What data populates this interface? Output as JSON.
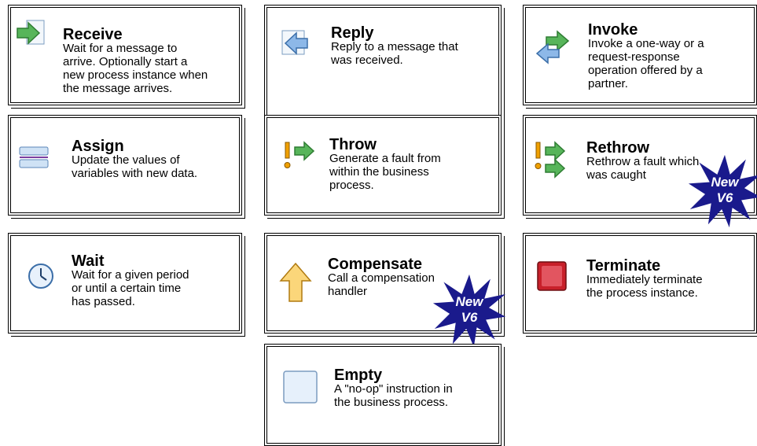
{
  "activities": [
    {
      "id": "receive",
      "title": "Receive",
      "description": "Wait for a message to\narrive. Optionally start a\nnew process instance when\nthe message arrives.",
      "icon": "receive-arrow-icon"
    },
    {
      "id": "reply",
      "title": "Reply",
      "description": "Reply to a message that\nwas received.",
      "icon": "reply-arrow-icon"
    },
    {
      "id": "invoke",
      "title": "Invoke",
      "description": "Invoke a one-way or a\nrequest-response\noperation offered by a\npartner.",
      "icon": "invoke-arrows-icon"
    },
    {
      "id": "assign",
      "title": "Assign",
      "description": "Update the values of\nvariables with new data.",
      "icon": "assign-icon"
    },
    {
      "id": "throw",
      "title": "Throw",
      "description": "Generate a fault from\nwithin the business\nprocess.",
      "icon": "throw-fault-icon"
    },
    {
      "id": "rethrow",
      "title": "Rethrow",
      "description": "Rethrow a fault which\nwas caught",
      "icon": "rethrow-fault-icon",
      "badge": {
        "line1": "New",
        "line2": "V6"
      }
    },
    {
      "id": "wait",
      "title": "Wait",
      "description": "Wait for a given period\nor until a certain time\nhas passed.",
      "icon": "clock-icon"
    },
    {
      "id": "compensate",
      "title": "Compensate",
      "description": "Call a compensation\nhandler",
      "icon": "compensate-up-arrow-icon",
      "badge": {
        "line1": "New",
        "line2": "V6"
      }
    },
    {
      "id": "terminate",
      "title": "Terminate",
      "description": "Immediately terminate\nthe process instance.",
      "icon": "terminate-stop-icon"
    },
    {
      "id": "empty",
      "title": "Empty",
      "description": "A \"no-op\" instruction in\nthe business process.",
      "icon": "empty-box-icon"
    }
  ],
  "colors": {
    "accent_green": "#3a9a3a",
    "accent_blue": "#5b9bd5",
    "badge": "#1a1a8c",
    "terminate_red": "#c8202a",
    "compensate_orange": "#f5a623"
  }
}
